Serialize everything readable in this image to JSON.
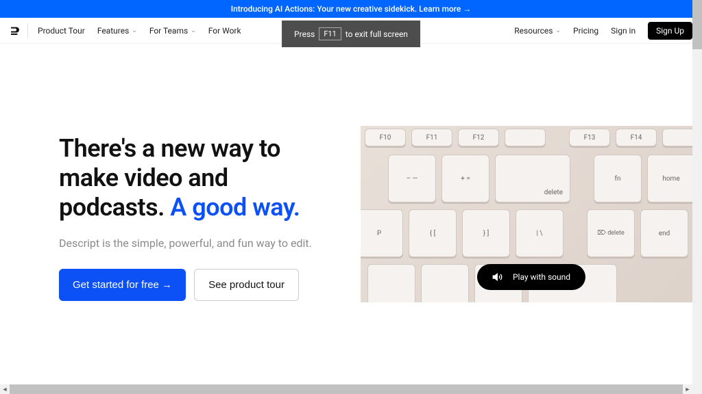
{
  "banner": {
    "text": "Introducing AI Actions: Your new creative sidekick. Learn more →"
  },
  "nav": {
    "items": [
      {
        "label": "Product Tour",
        "dropdown": false
      },
      {
        "label": "Features",
        "dropdown": true
      },
      {
        "label": "For Teams",
        "dropdown": true
      },
      {
        "label": "For Work",
        "dropdown": false
      }
    ],
    "right": [
      {
        "label": "Resources",
        "dropdown": true
      },
      {
        "label": "Pricing",
        "dropdown": false
      },
      {
        "label": "Sign in",
        "dropdown": false
      }
    ],
    "signup": "Sign Up"
  },
  "fullscreen": {
    "press": "Press",
    "key": "F11",
    "rest": "to exit full screen"
  },
  "hero": {
    "title_line1": "There's a new way to",
    "title_line2": "make video and",
    "title_line3": "podcasts. ",
    "title_accent": "A good way.",
    "subtitle": "Descript is the simple, powerful, and fun way to edit.",
    "cta_primary": "Get started for free →",
    "cta_secondary": "See product tour"
  },
  "video": {
    "play_label": "Play with sound",
    "keys_row0": [
      "F10",
      "F11",
      "F12",
      "",
      "F13",
      "F14",
      ""
    ],
    "keys_row1": [
      "–  —",
      "+  =",
      "delete",
      "fn",
      "home",
      ""
    ],
    "keys_row2": [
      "P",
      "{  [",
      "}  ]",
      "|  \\",
      "⌦ delete",
      "end"
    ],
    "keys_row3": [
      "",
      "",
      "",
      "",
      "",
      ""
    ]
  }
}
